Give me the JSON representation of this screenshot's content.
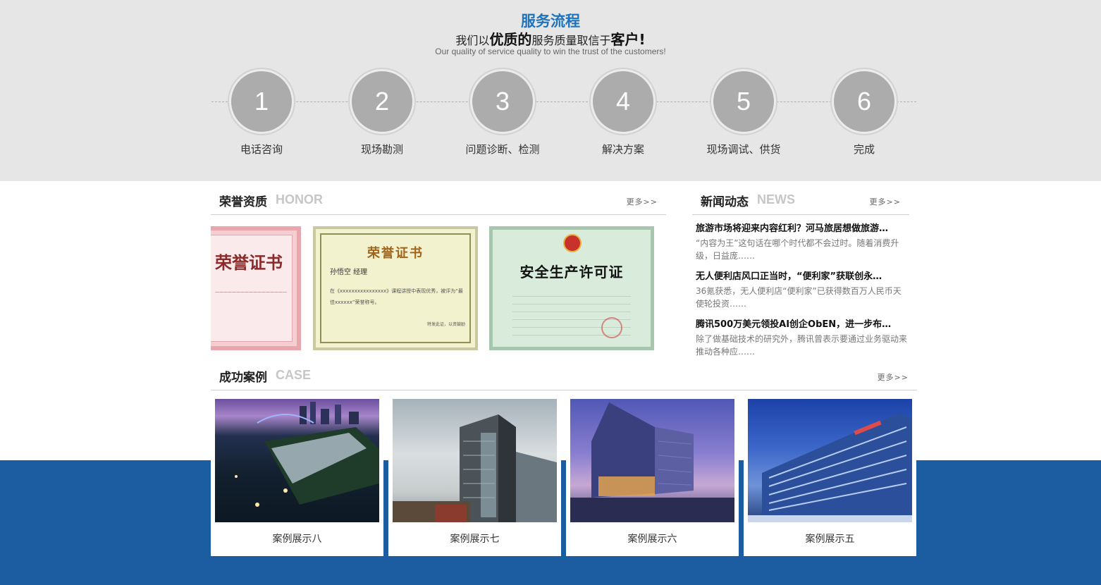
{
  "flow": {
    "title": "服务流程",
    "slogan": {
      "p1": "我们以",
      "b1": "优质的",
      "p2": "服务质量取信于",
      "b2": "客户!"
    },
    "subtitle_en": "Our quality of service quality to win the trust of the customers!",
    "steps": [
      {
        "num": "1",
        "label": "电话咨询"
      },
      {
        "num": "2",
        "label": "现场勘测"
      },
      {
        "num": "3",
        "label": "问题诊断、检测"
      },
      {
        "num": "4",
        "label": "解决方案"
      },
      {
        "num": "5",
        "label": "现场调试、供货"
      },
      {
        "num": "6",
        "label": "完成"
      }
    ]
  },
  "honor": {
    "title_cn": "荣誉资质",
    "title_en": "HONOR",
    "more": "更多>>",
    "certs": [
      {
        "title": "荣誉证书"
      },
      {
        "title": "荣誉证书",
        "name": "孙悟空 经理",
        "body": "在《xxxxxxxxxxxxxxxx》课程讲授中表现优秀，被评为“最佳xxxxxx”荣誉称号。",
        "sign": "特发此证，以资鼓励"
      },
      {
        "title": "安全生产许可证"
      }
    ]
  },
  "news": {
    "title_cn": "新闻动态",
    "title_en": "NEWS",
    "more": "更多>>",
    "items": [
      {
        "title": "旅游市场将迎来内容红利？河马旅居想做旅游…",
        "desc": "“内容为王”这句话在哪个时代都不会过时。随着消费升级，日益庞……"
      },
      {
        "title": "无人便利店风口正当时，“便利家”获联创永…",
        "desc": "36氪获悉，无人便利店“便利家”已获得数百万人民币天使轮投资……"
      },
      {
        "title": "腾讯500万美元领投AI创企ObEN，进一步布…",
        "desc": "除了做基础技术的研究外，腾讯曾表示要通过业务驱动来推动各种应……"
      }
    ]
  },
  "cases": {
    "title_cn": "成功案例",
    "title_en": "CASE",
    "more": "更多>>",
    "items": [
      {
        "caption": "案例展示八",
        "image": "night-harbor-city-photo"
      },
      {
        "caption": "案例展示七",
        "image": "office-tower-photo"
      },
      {
        "caption": "案例展示六",
        "image": "modern-building-dusk-photo"
      },
      {
        "caption": "案例展示五",
        "image": "glass-office-building-photo"
      }
    ]
  },
  "colors": {
    "accent": "#1e73be",
    "band": "#1b5da0",
    "step_circle": "#acacac"
  }
}
